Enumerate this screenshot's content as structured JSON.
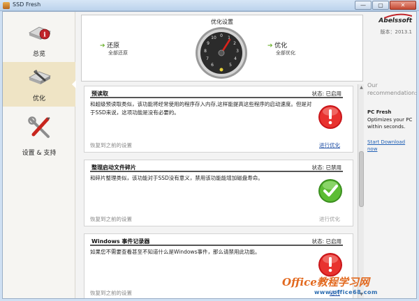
{
  "window": {
    "title": "SSD Fresh",
    "buttons": {
      "min": "—",
      "max": "▢",
      "close": "✕"
    }
  },
  "sidebar": {
    "items": [
      {
        "label": "总览",
        "icon": "ssd-info-icon",
        "active": false
      },
      {
        "label": "优化",
        "icon": "ssd-optimize-icon",
        "active": true
      },
      {
        "label": "设置 & 支持",
        "icon": "tools-icon",
        "active": false
      }
    ]
  },
  "header": {
    "title": "优化设置",
    "restore": {
      "label": "还原",
      "sub": "全部还原"
    },
    "optimize": {
      "label": "优化",
      "sub": "全部优化"
    },
    "gauge_icon": "speedometer-gauge-icon"
  },
  "brand": {
    "logo": "Abelssoft",
    "version": "版本：2013.1"
  },
  "recommendation": {
    "title": "Our recommendation:",
    "product": "PC Fresh",
    "desc": "Optimizes your PC within seconds.",
    "link": "Start Download now"
  },
  "cards": [
    {
      "title": "预读取",
      "status": "状态: 已启用",
      "desc": "和超级预读取类似，该功能将经常使用的程序存入内存,这样能提高这些程序的启动速度。但是对于SSD来说，这项功能是没有必要的。",
      "revert": "恢复到之前的设置",
      "action": "进行优化",
      "state_icon": "warning-icon",
      "action_enabled": true
    },
    {
      "title": "整理启动文件碎片",
      "status": "状态: 已禁用",
      "desc": "和碎片整理类似，该功能对于SSD没有意义，禁用该功能能增加磁盘寿命。",
      "revert": "恢复到之前的设置",
      "action": "进行优化",
      "state_icon": "check-icon",
      "action_enabled": false
    },
    {
      "title": "Windows 事件记录器",
      "status": "状态: 已启用",
      "desc": "如果您不需要查看甚至不知道什么是Windows事件，那么请禁用此功能。",
      "revert": "恢复到之前的设置",
      "action": "进行",
      "state_icon": "warning-icon",
      "action_enabled": true
    }
  ],
  "watermark": {
    "line1": "Office教程学习网",
    "line2": "www.office68.com"
  },
  "colors": {
    "accent": "#6cb12d",
    "warning": "#d51d1d",
    "ok": "#4aa628",
    "link": "#1f4fa5"
  }
}
